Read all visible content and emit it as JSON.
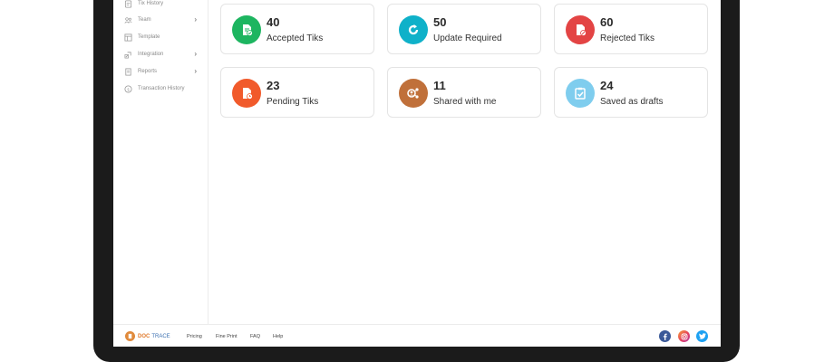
{
  "sidebar": {
    "items": [
      {
        "label": "Tix History",
        "icon": "history-icon",
        "has_chevron": false
      },
      {
        "label": "Team",
        "icon": "team-icon",
        "has_chevron": true
      },
      {
        "label": "Template",
        "icon": "template-icon",
        "has_chevron": false
      },
      {
        "label": "Integration",
        "icon": "integration-icon",
        "has_chevron": true
      },
      {
        "label": "Reports",
        "icon": "reports-icon",
        "has_chevron": true
      },
      {
        "label": "Transaction History",
        "icon": "dollar-icon",
        "has_chevron": false
      }
    ],
    "chevron": "›"
  },
  "cards": [
    {
      "count": "40",
      "label": "Accepted Tiks",
      "color": "#1db560",
      "icon": "document-check-icon"
    },
    {
      "count": "50",
      "label": "Update Required",
      "color": "#0fb1c9",
      "icon": "refresh-icon"
    },
    {
      "count": "60",
      "label": "Rejected Tiks",
      "color": "#e34444",
      "icon": "document-reject-icon"
    },
    {
      "count": "23",
      "label": "Pending Tiks",
      "color": "#f15a2b",
      "icon": "document-pending-icon"
    },
    {
      "count": "11",
      "label": "Shared with me",
      "color": "#c0703a",
      "icon": "shared-users-icon"
    },
    {
      "count": "24",
      "label": "Saved as drafts",
      "color": "#7fcdee",
      "icon": "clipboard-check-icon"
    }
  ],
  "footer": {
    "brand_part1": "DOC",
    "brand_part2": "TRACE",
    "links": [
      "Pricing",
      "Fine Print",
      "FAQ",
      "Help"
    ],
    "social": [
      {
        "icon": "facebook-icon",
        "glyph": "f",
        "color": "#3b5998"
      },
      {
        "icon": "instagram-icon",
        "glyph": "◎",
        "color": "#e4405f"
      },
      {
        "icon": "twitter-icon",
        "glyph": "t",
        "color": "#1da1f2"
      }
    ]
  }
}
